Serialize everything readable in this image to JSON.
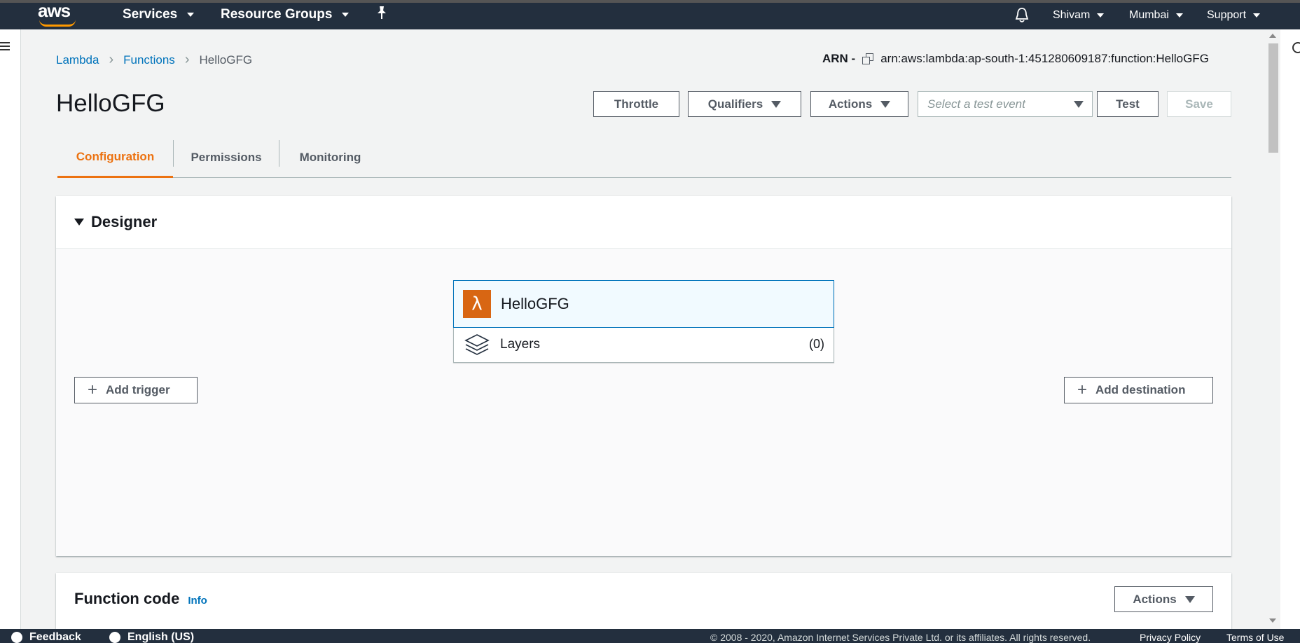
{
  "nav": {
    "logo": "aws",
    "services": "Services",
    "resource_groups": "Resource Groups",
    "user": "Shivam",
    "region": "Mumbai",
    "support": "Support"
  },
  "breadcrumb": {
    "root": "Lambda",
    "section": "Functions",
    "current": "HelloGFG"
  },
  "arn": {
    "label": "ARN -",
    "value": "arn:aws:lambda:ap-south-1:451280609187:function:HelloGFG"
  },
  "title": "HelloGFG",
  "toolbar": {
    "throttle": "Throttle",
    "qualifiers": "Qualifiers",
    "actions": "Actions",
    "test_event_placeholder": "Select a test event",
    "test": "Test",
    "save": "Save"
  },
  "tabs": [
    "Configuration",
    "Permissions",
    "Monitoring"
  ],
  "designer": {
    "title": "Designer",
    "function_name": "HelloGFG",
    "layers_label": "Layers",
    "layers_count": "(0)",
    "add_trigger": "Add trigger",
    "add_destination": "Add destination"
  },
  "function_code": {
    "title": "Function code",
    "info": "Info",
    "actions": "Actions"
  },
  "footer": {
    "feedback": "Feedback",
    "language": "English (US)",
    "copyright": "© 2008 - 2020, Amazon Internet Services Private Ltd. or its affiliates. All rights reserved.",
    "privacy": "Privacy Policy",
    "terms": "Terms of Use"
  },
  "colors": {
    "nav_bg": "#232f3e",
    "accent_orange": "#ec7211",
    "link_blue": "#0073bb",
    "lambda_orange": "#d86613"
  }
}
